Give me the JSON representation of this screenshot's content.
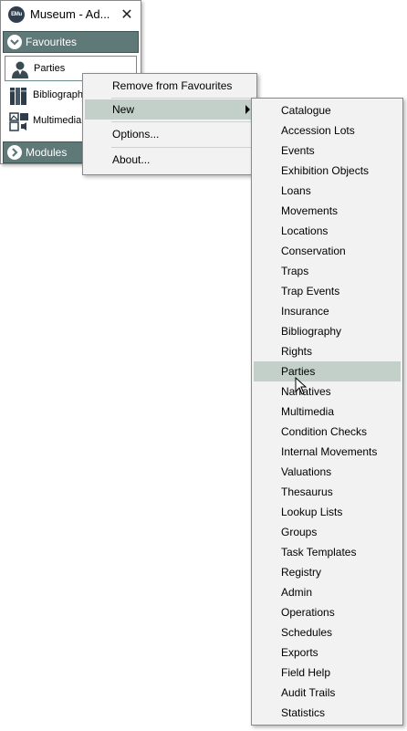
{
  "window": {
    "title": "Museum - Ad...",
    "logo_text": "EMu",
    "close_glyph": "✕"
  },
  "sections": {
    "favourites_label": "Favourites",
    "modules_label": "Modules"
  },
  "favourites": [
    {
      "label": "Parties",
      "icon": "person-icon",
      "selected": true
    },
    {
      "label": "Bibliography",
      "icon": "books-icon",
      "selected": false
    },
    {
      "label": "Multimedia",
      "icon": "multimedia-icon",
      "selected": false
    }
  ],
  "context_menu": {
    "remove": "Remove from Favourites",
    "new": "New",
    "options": "Options...",
    "about": "About..."
  },
  "submenu": [
    "Catalogue",
    "Accession Lots",
    "Events",
    "Exhibition Objects",
    "Loans",
    "Movements",
    "Locations",
    "Conservation",
    "Traps",
    "Trap Events",
    "Insurance",
    "Bibliography",
    "Rights",
    "Parties",
    "Narratives",
    "Multimedia",
    "Condition Checks",
    "Internal Movements",
    "Valuations",
    "Thesaurus",
    "Lookup Lists",
    "Groups",
    "Task Templates",
    "Registry",
    "Admin",
    "Operations",
    "Schedules",
    "Exports",
    "Field Help",
    "Audit Trails",
    "Statistics"
  ],
  "colors": {
    "section_bar": "#5f7878",
    "menu_highlight": "#c3cfc9",
    "menu_bg": "#f2f2f2"
  }
}
